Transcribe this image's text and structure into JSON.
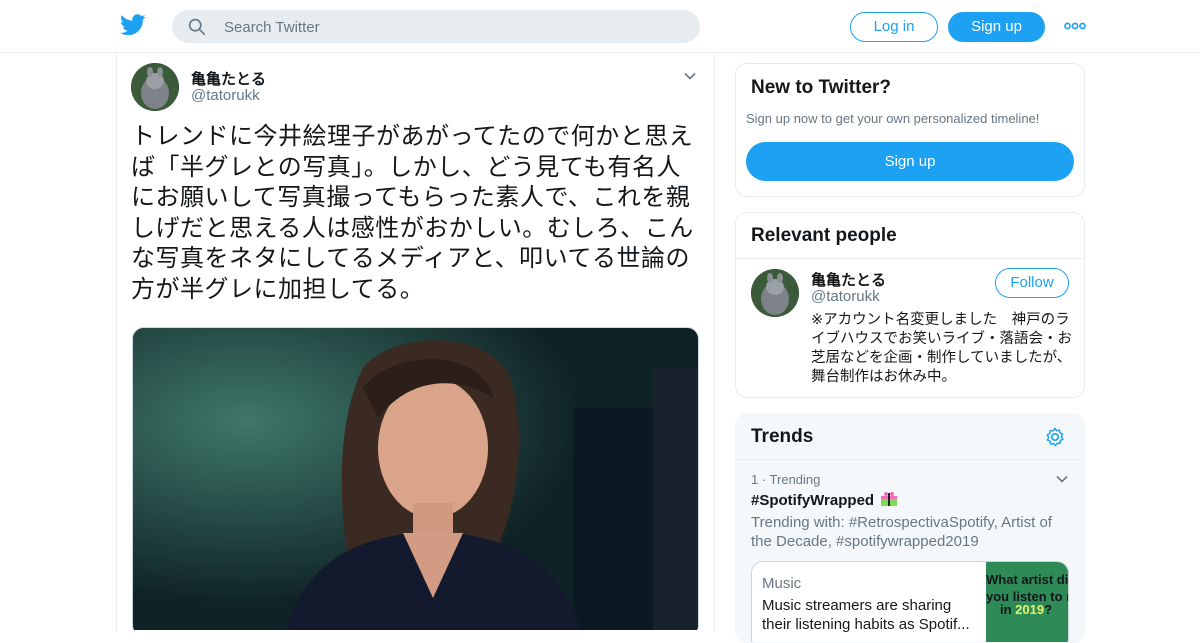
{
  "topbar": {
    "logo_icon": "twitter-bird-icon",
    "search_placeholder": "Search Twitter",
    "login_label": "Log in",
    "signup_label": "Sign up",
    "brand_color": "#1da1f2"
  },
  "tweet": {
    "author_name": "亀亀たとる",
    "author_handle": "@tatorukk",
    "text": "トレンドに今井絵理子があがってたので何かと思えば「半グレとの写真」。しかし、どう見ても有名人にお願いして写真撮ってもらった素人で、これを親しげだと思える人は感性がおかしい。むしろ、こんな写真をネタにしてるメディアと、叩いてる世論の方が半グレに加担してる。"
  },
  "new_to_twitter": {
    "title": "New to Twitter?",
    "subtitle": "Sign up now to get your own personalized timeline!",
    "signup_label": "Sign up"
  },
  "relevant_people": {
    "title": "Relevant people",
    "person": {
      "name": "亀亀たとる",
      "handle": "@tatorukk",
      "follow_label": "Follow",
      "bio": "※アカウント名変更しました　神戸のライブハウスでお笑いライブ・落語会・お芝居などを企画・制作していましたが、舞台制作はお休み中。"
    }
  },
  "trends": {
    "title": "Trends",
    "items": [
      {
        "meta": "1 · Trending",
        "tag": "#SpotifyWrapped",
        "trending_with": "Trending with: #RetrospectivaSpotify, Artist of the Decade, #spotifywrapped2019",
        "card": {
          "label": "Music",
          "description": "Music streamers are sharing their listening habits as Spotif...",
          "thumb_line1": "What artist did",
          "thumb_line2": "you listen to mo",
          "thumb_line3_pre": "in ",
          "thumb_year": "2019",
          "thumb_line3_post": "?"
        }
      }
    ]
  }
}
